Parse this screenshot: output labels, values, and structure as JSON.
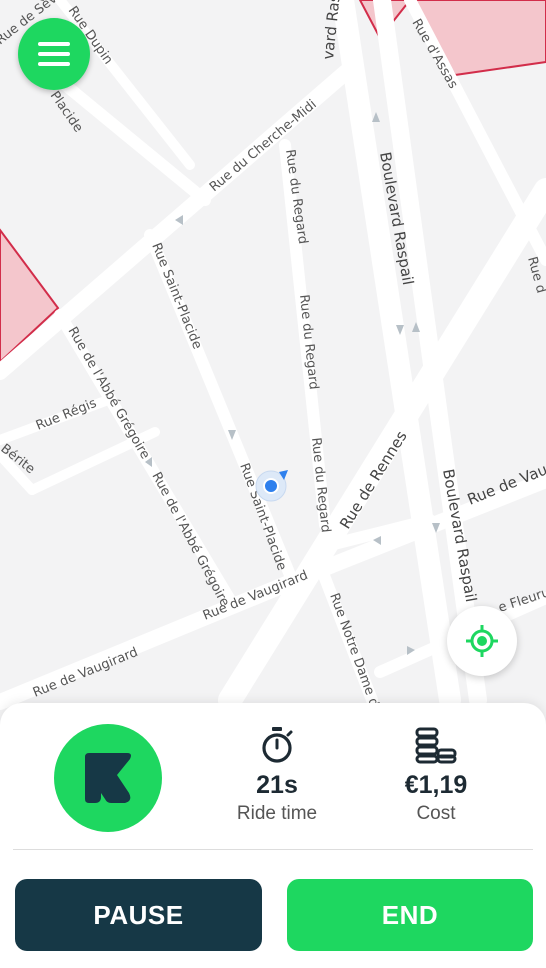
{
  "map": {
    "streets": [
      "Rue de Sèvres",
      "Rue Dupin",
      "Rue Saint-Placide",
      "Rue du Cherche-Midi",
      "Rue du Regard",
      "Boulevard Raspail",
      "Rue d'Assas",
      "Rue Régis",
      "Rue de l'Abbé Grégoire",
      "Rue Bérite",
      "Rue de Rennes",
      "Rue de Vaugirard",
      "Rue Notre Dame des Champs",
      "Rue de Fleurus"
    ],
    "labels": {
      "sevres": "Rue de Sèvres",
      "dupin": "Rue Dupin",
      "placide_top": "Placide",
      "cherche_midi": "Rue du Cherche-Midi",
      "regard_1": "Rue du Regard",
      "regard_2": "Rue du Regard",
      "regard_3": "Rue du Regard",
      "raspail_top": "vard Raspail",
      "raspail_mid": "Boulevard Raspail",
      "raspail_bottom": "Boulevard Raspail",
      "assas": "Rue d'Assas",
      "right_edge": "Rue d",
      "saint_placide_1": "Rue Saint-Placide",
      "saint_placide_2": "Rue Saint-Placide",
      "abbe_gregoire_1": "Rue de l'Abbé Grégoire",
      "abbe_gregoire_2": "Rue de l'Abbé Grégoire",
      "regis": "Rue Régis",
      "berite": "Bérite",
      "rennes": "Rue de Rennes",
      "vaugirard_1": "Rue de Vaugirard",
      "vaugirard_2": "Rue de Vaugirard",
      "vaugirard_right": "Rue de Vaug",
      "notre_dame": "Rue Notre Dame des",
      "fleurus": "e Fleurus"
    },
    "colors": {
      "background": "#f3f3f4",
      "road": "#ffffff",
      "zone": "#f4c6cc",
      "zone_border": "#d22d4a",
      "position": "#2f80ed"
    }
  },
  "controls": {
    "menu_icon": "hamburger-menu-icon",
    "locate_icon": "crosshair-target-icon"
  },
  "ride": {
    "brand_icon": "brand-k-logo-icon",
    "time": {
      "icon": "stopwatch-icon",
      "value": "21s",
      "label": "Ride time"
    },
    "cost": {
      "icon": "coin-stack-icon",
      "value": "€1,19",
      "label": "Cost"
    }
  },
  "actions": {
    "pause_label": "PAUSE",
    "end_label": "END"
  },
  "colors": {
    "accent": "#1ed760",
    "dark": "#163846",
    "text": "#1d2a33"
  }
}
